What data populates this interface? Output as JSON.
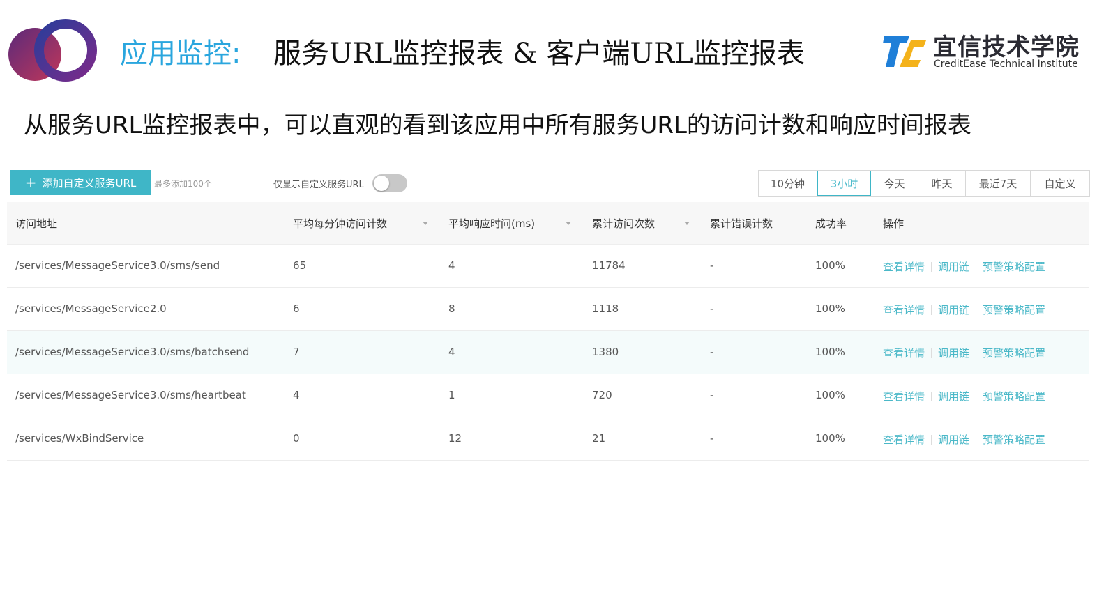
{
  "header": {
    "title_accent": "应用监控:",
    "title_main": "服务URL监控报表 & 客户端URL监控报表",
    "brand_cn": "宜信技术学院",
    "brand_en": "CreditEase Technical Institute"
  },
  "subtitle": "从服务URL监控报表中，可以直观的看到该应用中所有服务URL的访问计数和响应时间报表",
  "toolbar": {
    "add_label": "添加自定义服务URL",
    "hint": "最多添加100个",
    "toggle_label": "仅显示自定义服务URL",
    "toggle_on": false,
    "time_ranges": [
      "10分钟",
      "3小时",
      "今天",
      "昨天",
      "最近7天",
      "自定义"
    ],
    "active_range": "3小时"
  },
  "table": {
    "columns": [
      "访问地址",
      "平均每分钟访问计数",
      "平均响应时间(ms)",
      "累计访问次数",
      "累计错误计数",
      "成功率",
      "操作"
    ],
    "rows": [
      [
        "/services/MessageService3.0/sms/send",
        "65",
        "4",
        "11784",
        "-",
        "100%"
      ],
      [
        "/services/MessageService2.0",
        "6",
        "8",
        "1118",
        "-",
        "100%"
      ],
      [
        "/services/MessageService3.0/sms/batchsend",
        "7",
        "4",
        "1380",
        "-",
        "100%"
      ],
      [
        "/services/MessageService3.0/sms/heartbeat",
        "4",
        "1",
        "720",
        "-",
        "100%"
      ],
      [
        "/services/WxBindService",
        "0",
        "12",
        "21",
        "-",
        "100%"
      ]
    ],
    "actions": [
      "查看详情",
      "调用链",
      "预警策略配置"
    ]
  },
  "colors": {
    "accent": "#3fb6c7",
    "title_blue": "#2aa6de",
    "link": "#4ab8c8"
  }
}
